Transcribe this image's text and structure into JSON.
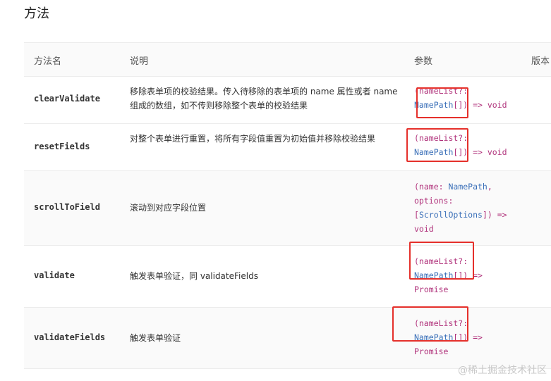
{
  "section_title": "方法",
  "columns": {
    "name": "方法名",
    "description": "说明",
    "params": "参数",
    "version": "版本"
  },
  "rows": [
    {
      "name": "clearValidate",
      "description": "移除表单项的校验结果。传入待移除的表单项的 name 属性或者 name 组成的数组，如不传则移除整个表单的校验结果",
      "sig": {
        "a": "(nameList?:",
        "b": "NamePath",
        "c": "[]) => void"
      }
    },
    {
      "name": "resetFields",
      "description": "对整个表单进行重置，将所有字段值重置为初始值并移除校验结果",
      "sig": {
        "a": "(nameList?:",
        "b": "NamePath",
        "c": "[]) => void"
      }
    },
    {
      "name": "scrollToField",
      "description": "滚动到对应字段位置",
      "sig": {
        "a": "(name: ",
        "b": "NamePath",
        "c": ",",
        "d": "options:",
        "e": "[",
        "f": "ScrollOptions",
        "g": "]) =>",
        "h": "void"
      }
    },
    {
      "name": "validate",
      "description": "触发表单验证，同 validateFields",
      "sig": {
        "a": "(nameList?:",
        "b": "NamePath",
        "c": "[]) =>",
        "d": "Promise"
      }
    },
    {
      "name": "validateFields",
      "description": "触发表单验证",
      "sig": {
        "a": "(nameList?:",
        "b": "NamePath",
        "c": "[]) =>",
        "d": "Promise"
      }
    }
  ],
  "watermark": "@稀土掘金技术社区"
}
